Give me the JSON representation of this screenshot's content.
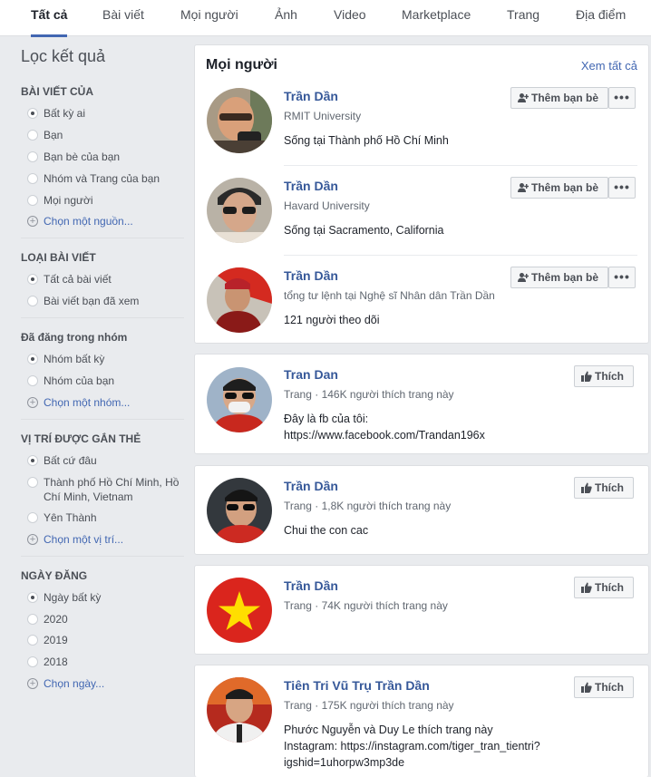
{
  "tabs": [
    "Tất cả",
    "Bài viết",
    "Mọi người",
    "Ảnh",
    "Video",
    "Marketplace",
    "Trang",
    "Địa điểm"
  ],
  "sidebar": {
    "title": "Lọc kết quả",
    "sections": [
      {
        "heading": "BÀI VIẾT CỦA",
        "options": [
          "Bất kỳ ai",
          "Bạn",
          "Bạn bè của bạn",
          "Nhóm và Trang của bạn",
          "Mọi người"
        ],
        "selected": 0,
        "more": "Chọn một nguồn..."
      },
      {
        "heading": "LOẠI BÀI VIẾT",
        "options": [
          "Tất cả bài viết",
          "Bài viết bạn đã xem"
        ],
        "selected": 0,
        "more": ""
      },
      {
        "heading": "Đã đăng trong nhóm",
        "options": [
          "Nhóm bất kỳ",
          "Nhóm của bạn"
        ],
        "selected": 0,
        "more": "Chọn một nhóm..."
      },
      {
        "heading": "VỊ TRÍ ĐƯỢC GẮN THẺ",
        "options": [
          "Bất cứ đâu",
          "Thành phố Hồ Chí Minh, Hồ Chí Minh, Vietnam",
          "Yên Thành"
        ],
        "selected": 0,
        "more": "Chọn một vị trí..."
      },
      {
        "heading": "NGÀY ĐĂNG",
        "options": [
          "Ngày bất kỳ",
          "2020",
          "2019",
          "2018"
        ],
        "selected": 0,
        "more": "Chọn ngày..."
      }
    ]
  },
  "people": {
    "title": "Mọi người",
    "see_all": "Xem tất cả",
    "add_friend_label": "Thêm bạn bè",
    "items": [
      {
        "name": "Trần Dần",
        "sub": "RMIT University",
        "line1": "Sống tại Thành phố Hồ Chí Minh"
      },
      {
        "name": "Trần Dần",
        "sub": "Havard University",
        "line1": "Sống tại Sacramento, California"
      },
      {
        "name": "Trần Dần",
        "sub": "tổng tư lệnh tại Nghệ sĩ Nhân dân Trần Dần",
        "line1": "121 người theo dõi"
      }
    ]
  },
  "like_label": "Thích",
  "pages": [
    {
      "name": "Tran Dan",
      "sub": "Trang · 146K người thích trang này",
      "line1": "Đây là fb của tôi:",
      "line2": "https://www.facebook.com/Trandan196x"
    },
    {
      "name": "Trần Dần",
      "sub": "Trang · 1,8K người thích trang này",
      "line1": "Chui the con cac"
    },
    {
      "name": "Trần Dần",
      "sub": "Trang · 74K người thích trang này"
    },
    {
      "name": "Tiên Tri Vũ Trụ Trần Dần",
      "sub": "Trang · 175K người thích trang này",
      "line1": "Phước Nguyễn và Duy Le thích trang này",
      "line2": "Instagram: https://instagram.com/tiger_tran_tientri?",
      "line3": "igshid=1uhorpw3mp3de"
    }
  ],
  "colors": {
    "link": "#365899",
    "accent": "#4267b2",
    "flag_red": "#da251d",
    "flag_star": "#ffde00"
  },
  "icons": {
    "add_friend": "person-plus-icon",
    "like": "thumbs-up-icon",
    "more": "more-dots-icon",
    "add_option": "plus-circle-icon"
  }
}
